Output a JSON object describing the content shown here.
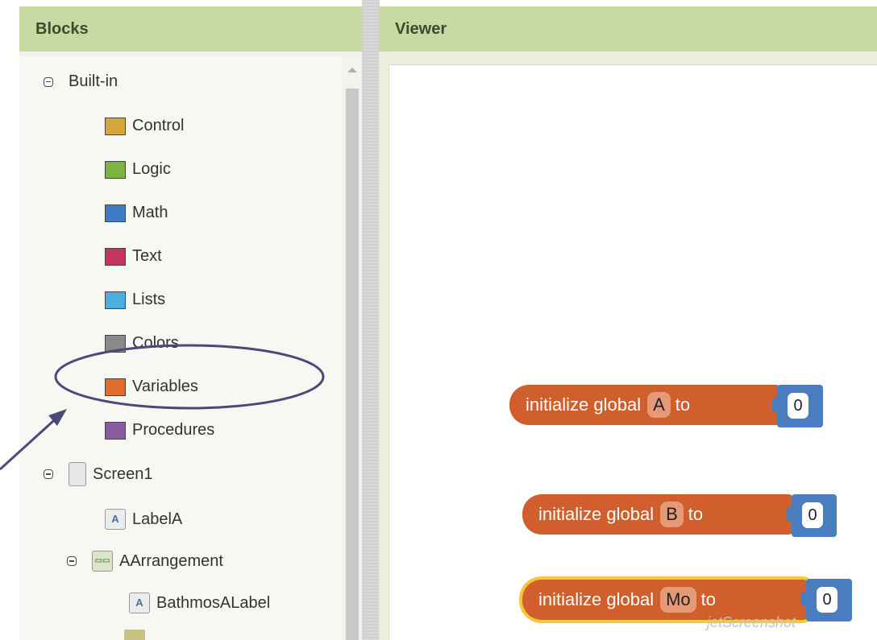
{
  "blocks_panel": {
    "title": "Blocks"
  },
  "viewer_panel": {
    "title": "Viewer"
  },
  "tree": {
    "builtin_label": "Built-in",
    "categories": [
      {
        "label": "Control",
        "color": "#d5a73b"
      },
      {
        "label": "Logic",
        "color": "#7cb342"
      },
      {
        "label": "Math",
        "color": "#3e7cc4"
      },
      {
        "label": "Text",
        "color": "#c23660"
      },
      {
        "label": "Lists",
        "color": "#4aaee0"
      },
      {
        "label": "Colors",
        "color": "#8a8a8a"
      },
      {
        "label": "Variables",
        "color": "#e06b2c"
      },
      {
        "label": "Procedures",
        "color": "#8a5aa0"
      }
    ],
    "screen_label": "Screen1",
    "label_a": "LabelA",
    "arrangement_label": "AArrangement",
    "bathmos_label": "BathmosALabel",
    "component_icon_letter": "A"
  },
  "workspace_blocks": [
    {
      "prefix": "initialize global",
      "var": "A",
      "to": "to",
      "value": "0",
      "selected": false
    },
    {
      "prefix": "initialize global",
      "var": "B",
      "to": "to",
      "value": "0",
      "selected": false
    },
    {
      "prefix": "initialize global",
      "var": "Mo",
      "to": "to",
      "value": "0",
      "selected": true
    }
  ],
  "colors": {
    "panel_header": "#c8d9a3",
    "variable_block": "#d05f2d",
    "math_socket": "#4a7cc0",
    "selection_outline": "#f7c63b",
    "annotation": "#4a4a7a"
  },
  "watermark": "jetScreenshot"
}
